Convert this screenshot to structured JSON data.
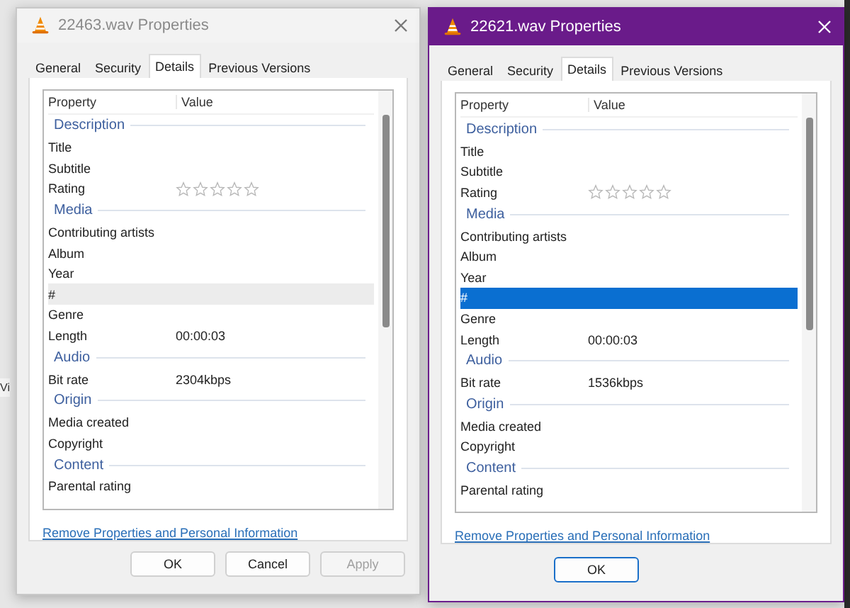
{
  "background_text": "Vi",
  "windows": [
    {
      "title": "22463.wav Properties",
      "active": false,
      "tabs": [
        {
          "label": "General",
          "selected": false
        },
        {
          "label": "Security",
          "selected": false
        },
        {
          "label": "Details",
          "selected": true
        },
        {
          "label": "Previous Versions",
          "selected": false
        }
      ],
      "columns": [
        "Property",
        "Value"
      ],
      "rows": [
        {
          "kind": "group",
          "label": "Description"
        },
        {
          "kind": "text",
          "property": "Title",
          "selected": false,
          "hovered": false
        },
        {
          "kind": "text",
          "property": "Subtitle",
          "selected": false,
          "hovered": false
        },
        {
          "kind": "rating",
          "property": "Rating",
          "stars": 0,
          "selected": false,
          "hovered": false
        },
        {
          "kind": "group",
          "label": "Media"
        },
        {
          "kind": "text",
          "property": "Contributing artists",
          "selected": false,
          "hovered": false
        },
        {
          "kind": "text",
          "property": "Album",
          "selected": false,
          "hovered": false
        },
        {
          "kind": "text",
          "property": "Year",
          "selected": false,
          "hovered": false
        },
        {
          "kind": "text",
          "property": "#",
          "selected": false,
          "hovered": true
        },
        {
          "kind": "text",
          "property": "Genre",
          "selected": false,
          "hovered": false
        },
        {
          "kind": "text",
          "property": "Length",
          "value": "00:00:03",
          "selected": false,
          "hovered": false
        },
        {
          "kind": "group",
          "label": "Audio"
        },
        {
          "kind": "text",
          "property": "Bit rate",
          "value": "2304kbps",
          "selected": false,
          "hovered": false
        },
        {
          "kind": "group",
          "label": "Origin"
        },
        {
          "kind": "text",
          "property": "Media created",
          "selected": false,
          "hovered": false
        },
        {
          "kind": "text",
          "property": "Copyright",
          "selected": false,
          "hovered": false
        },
        {
          "kind": "group",
          "label": "Content"
        },
        {
          "kind": "text",
          "property": "Parental rating",
          "selected": false,
          "hovered": false
        }
      ],
      "link": "Remove Properties and Personal Information",
      "buttons": [
        {
          "label": "OK",
          "disabled": false,
          "default": false
        },
        {
          "label": "Cancel",
          "disabled": false,
          "default": false
        },
        {
          "label": "Apply",
          "disabled": true,
          "default": false
        }
      ]
    },
    {
      "title": "22621.wav Properties",
      "active": true,
      "tabs": [
        {
          "label": "General",
          "selected": false
        },
        {
          "label": "Security",
          "selected": false
        },
        {
          "label": "Details",
          "selected": true
        },
        {
          "label": "Previous Versions",
          "selected": false
        }
      ],
      "columns": [
        "Property",
        "Value"
      ],
      "rows": [
        {
          "kind": "group",
          "label": "Description"
        },
        {
          "kind": "text",
          "property": "Title",
          "selected": false,
          "hovered": false
        },
        {
          "kind": "text",
          "property": "Subtitle",
          "selected": false,
          "hovered": false
        },
        {
          "kind": "rating",
          "property": "Rating",
          "stars": 0,
          "selected": false,
          "hovered": false
        },
        {
          "kind": "group",
          "label": "Media"
        },
        {
          "kind": "text",
          "property": "Contributing artists",
          "selected": false,
          "hovered": false
        },
        {
          "kind": "text",
          "property": "Album",
          "selected": false,
          "hovered": false
        },
        {
          "kind": "text",
          "property": "Year",
          "selected": false,
          "hovered": false
        },
        {
          "kind": "text",
          "property": "#",
          "selected": true,
          "hovered": false
        },
        {
          "kind": "text",
          "property": "Genre",
          "selected": false,
          "hovered": false
        },
        {
          "kind": "text",
          "property": "Length",
          "value": "00:00:03",
          "selected": false,
          "hovered": false
        },
        {
          "kind": "group",
          "label": "Audio"
        },
        {
          "kind": "text",
          "property": "Bit rate",
          "value": "1536kbps",
          "selected": false,
          "hovered": false
        },
        {
          "kind": "group",
          "label": "Origin"
        },
        {
          "kind": "text",
          "property": "Media created",
          "selected": false,
          "hovered": false
        },
        {
          "kind": "text",
          "property": "Copyright",
          "selected": false,
          "hovered": false
        },
        {
          "kind": "group",
          "label": "Content"
        },
        {
          "kind": "text",
          "property": "Parental rating",
          "selected": false,
          "hovered": false
        }
      ],
      "link": "Remove Properties and Personal Information",
      "buttons": [
        {
          "label": "OK",
          "disabled": false,
          "default": true
        }
      ]
    }
  ]
}
